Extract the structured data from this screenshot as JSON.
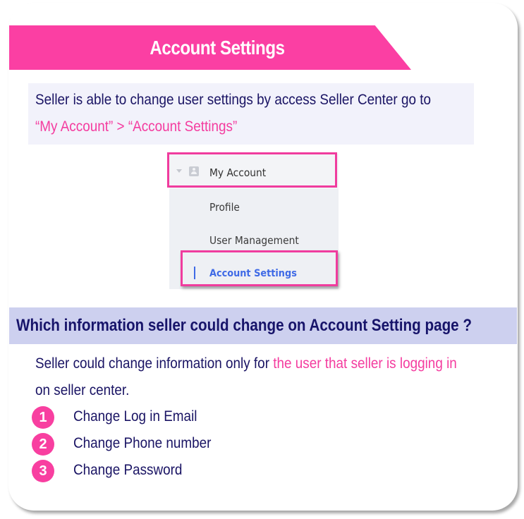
{
  "title": "Account Settings",
  "intro": {
    "line1": "Seller is able to change user settings by access Seller Center go to",
    "line2": "“My Account” > “Account Settings”"
  },
  "menu_screenshot": {
    "parent": {
      "label": "My Account",
      "icon": "account-icon",
      "caret": "caret-down-icon"
    },
    "items": [
      {
        "label": "Profile",
        "active": false
      },
      {
        "label": "User Management",
        "active": false
      },
      {
        "label": "Account Settings",
        "active": true
      }
    ]
  },
  "question": "Which information seller could change on Account Setting page ?",
  "explanation": {
    "part1": "Seller could change information only for ",
    "part2_highlight": "the user that seller is logging in",
    "line2": "on seller center."
  },
  "changes": [
    {
      "number": "1",
      "label": "Change Log in Email"
    },
    {
      "number": "2",
      "label": "Change Phone number"
    },
    {
      "number": "3",
      "label": "Change Password"
    }
  ],
  "colors": {
    "accent_pink": "#fb3fa3",
    "navy_text": "#1a1464",
    "question_bg": "#cdd0ef",
    "intro_bg": "#f2f2fb",
    "active_blue": "#3f6ae6"
  }
}
